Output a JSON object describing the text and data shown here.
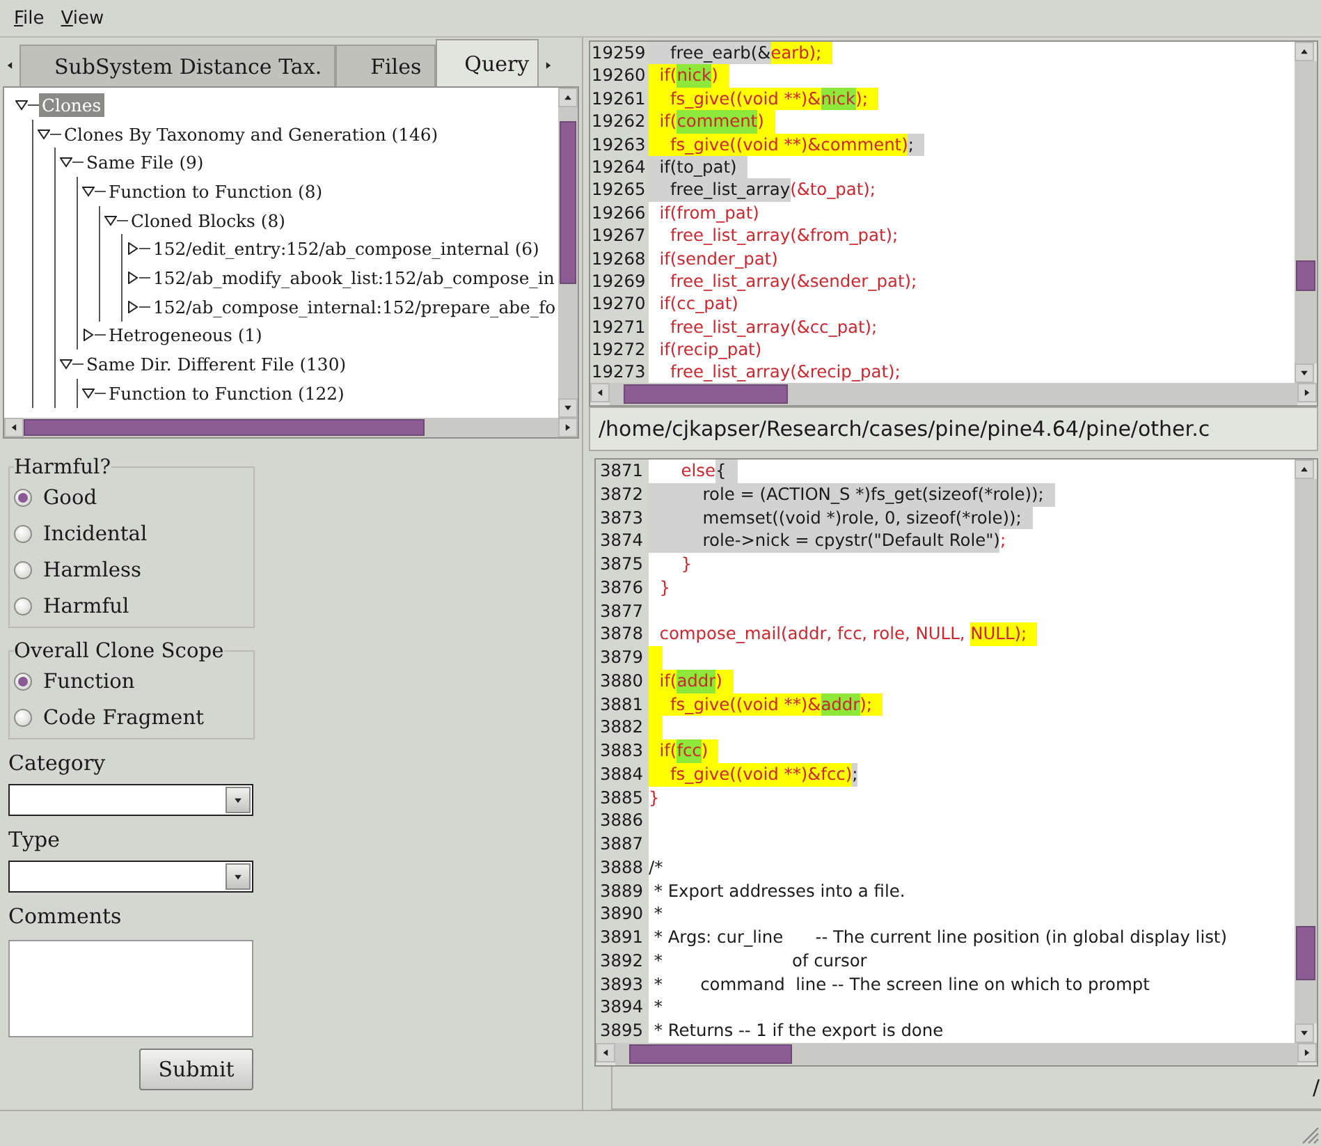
{
  "menu": [
    {
      "label": "File"
    },
    {
      "label": "View"
    }
  ],
  "tabs": [
    {
      "label": "SubSystem Distance Tax.",
      "selected": false
    },
    {
      "label": "Files",
      "selected": false
    },
    {
      "label": "Query",
      "selected": true
    }
  ],
  "tree": [
    {
      "label": "Clones",
      "selected": true,
      "expanded": true,
      "children": [
        {
          "label": "Clones By Taxonomy and Generation (146)",
          "selected": false,
          "expanded": true,
          "children": [
            {
              "label": "Same File (9)",
              "selected": false,
              "expanded": true,
              "children": [
                {
                  "label": "Function to Function (8)",
                  "selected": false,
                  "expanded": true,
                  "children": [
                    {
                      "label": "Cloned Blocks (8)",
                      "selected": false,
                      "expanded": true,
                      "children": [
                        {
                          "label": "152/edit_entry:152/ab_compose_internal (6)",
                          "selected": false,
                          "expanded": false
                        },
                        {
                          "label": "152/ab_modify_abook_list:152/ab_compose_in",
                          "selected": false,
                          "expanded": false
                        },
                        {
                          "label": "152/ab_compose_internal:152/prepare_abe_fo",
                          "selected": false,
                          "expanded": false
                        }
                      ]
                    }
                  ]
                },
                {
                  "label": "Hetrogeneous (1)",
                  "selected": false,
                  "expanded": false
                }
              ]
            },
            {
              "label": "Same Dir. Different File (130)",
              "selected": false,
              "expanded": true,
              "children": [
                {
                  "label": "Function to Function (122)",
                  "selected": false,
                  "expanded": true
                }
              ]
            }
          ]
        }
      ]
    }
  ],
  "form": {
    "groups": [
      {
        "title": "Harmful?",
        "options": [
          {
            "label": "Good",
            "selected": true
          },
          {
            "label": "Incidental",
            "selected": false
          },
          {
            "label": "Harmless",
            "selected": false
          },
          {
            "label": "Harmful",
            "selected": false
          }
        ]
      },
      {
        "title": "Overall Clone Scope",
        "options": [
          {
            "label": "Function",
            "selected": true
          },
          {
            "label": "Code Fragment",
            "selected": false
          }
        ]
      }
    ],
    "fields": [
      {
        "label": "Category",
        "kind": "dropdown"
      },
      {
        "label": "Type",
        "kind": "dropdown"
      },
      {
        "label": "Comments",
        "kind": "textarea"
      }
    ],
    "submit": "Submit"
  },
  "editors": [
    {
      "path": "/home/cjkapser/Research/cases/pine/pine4.64/pine/other.c",
      "lines": [
        {
          "num": "19259",
          "segments": [
            {
              "text": "    free_earb(&",
              "color": "#d2d2d2",
              "kind": "plain"
            },
            {
              "text": "earb);  ",
              "color": "#ffff00",
              "kind": "clone"
            }
          ]
        },
        {
          "num": "19260",
          "segments": [
            {
              "text": "  if(",
              "color": "#ffff00",
              "kind": "clone"
            },
            {
              "text": "nick",
              "color": "#8ee83a",
              "kind": "clone"
            },
            {
              "text": ")  ",
              "color": "#ffff00",
              "kind": "clone"
            }
          ]
        },
        {
          "num": "19261",
          "segments": [
            {
              "text": "    fs_give((void **)&",
              "color": "#ffff00",
              "kind": "clone"
            },
            {
              "text": "nick",
              "color": "#8ee83a",
              "kind": "clone"
            },
            {
              "text": ");  ",
              "color": "#ffff00",
              "kind": "clone"
            }
          ]
        },
        {
          "num": "19262",
          "segments": [
            {
              "text": "  if(",
              "color": "#ffff00",
              "kind": "clone"
            },
            {
              "text": "comment",
              "color": "#8ee83a",
              "kind": "clone"
            },
            {
              "text": ")  ",
              "color": "#ffff00",
              "kind": "clone"
            }
          ]
        },
        {
          "num": "19263",
          "segments": [
            {
              "text": "    fs_give((void **)&comment)",
              "color": "#ffff00",
              "kind": "clone"
            },
            {
              "text": ";  ",
              "color": "#d2d2d2",
              "kind": "plain"
            }
          ]
        },
        {
          "num": "19264",
          "segments": [
            {
              "text": "  if(to_pat)  ",
              "color": "#d2d2d2",
              "kind": "plain"
            }
          ]
        },
        {
          "num": "19265",
          "segments": [
            {
              "text": "    free_list_array",
              "color": "#d2d2d2",
              "kind": "plain"
            },
            {
              "text": "(&to_pat);",
              "kind": "clone"
            }
          ]
        },
        {
          "num": "19266",
          "segments": [
            {
              "text": "  if(from_pat)",
              "kind": "clone"
            }
          ]
        },
        {
          "num": "19267",
          "segments": [
            {
              "text": "    free_list_array(&from_pat);",
              "kind": "clone"
            }
          ]
        },
        {
          "num": "19268",
          "segments": [
            {
              "text": "  if(sender_pat)",
              "kind": "clone"
            }
          ]
        },
        {
          "num": "19269",
          "segments": [
            {
              "text": "    free_list_array(&sender_pat);",
              "kind": "clone"
            }
          ]
        },
        {
          "num": "19270",
          "segments": [
            {
              "text": "  if(cc_pat)",
              "kind": "clone"
            }
          ]
        },
        {
          "num": "19271",
          "segments": [
            {
              "text": "    free_list_array(&cc_pat);",
              "kind": "clone"
            }
          ]
        },
        {
          "num": "19272",
          "segments": [
            {
              "text": "  if(recip_pat)",
              "kind": "clone"
            }
          ]
        },
        {
          "num": "19273",
          "segments": [
            {
              "text": "    free_list_array(&recip_pat);",
              "kind": "clone"
            }
          ]
        }
      ]
    },
    {
      "path": "/",
      "lines": [
        {
          "num": "3871",
          "segments": [
            {
              "text": "      else",
              "kind": "clone"
            },
            {
              "text": "{  ",
              "color": "#d2d2d2",
              "kind": "plain"
            }
          ]
        },
        {
          "num": "3872",
          "segments": [
            {
              "text": "          role = (ACTION_S *)fs_get(sizeof(*role));  ",
              "color": "#d2d2d2",
              "kind": "plain"
            }
          ]
        },
        {
          "num": "3873",
          "segments": [
            {
              "text": "          memset((void *)role, 0, sizeof(*role));  ",
              "color": "#d2d2d2",
              "kind": "plain"
            }
          ]
        },
        {
          "num": "3874",
          "segments": [
            {
              "text": "          role->nick = cpystr(\"Default Role\")",
              "color": "#d2d2d2",
              "kind": "plain"
            },
            {
              "text": ";",
              "kind": "clone"
            }
          ]
        },
        {
          "num": "3875",
          "segments": [
            {
              "text": "      }",
              "kind": "clone"
            }
          ]
        },
        {
          "num": "3876",
          "segments": [
            {
              "text": "  }",
              "kind": "clone"
            }
          ]
        },
        {
          "num": "3877"
        },
        {
          "num": "3878",
          "segments": [
            {
              "text": "  compose_mail(addr, fcc, role, NULL, ",
              "kind": "clone"
            },
            {
              "text": "NULL);  ",
              "color": "#ffff00",
              "kind": "clone"
            }
          ]
        },
        {
          "num": "3879",
          "color": "#ffff00"
        },
        {
          "num": "3880",
          "segments": [
            {
              "text": "  if(",
              "color": "#ffff00",
              "kind": "clone"
            },
            {
              "text": "addr",
              "color": "#8ee83a",
              "kind": "clone"
            },
            {
              "text": ")  ",
              "color": "#ffff00",
              "kind": "clone"
            }
          ]
        },
        {
          "num": "3881",
          "segments": [
            {
              "text": "    fs_give((void **)&",
              "color": "#ffff00",
              "kind": "clone"
            },
            {
              "text": "addr",
              "color": "#8ee83a",
              "kind": "clone"
            },
            {
              "text": ");  ",
              "color": "#ffff00",
              "kind": "clone"
            }
          ]
        },
        {
          "num": "3882",
          "color": "#ffff00"
        },
        {
          "num": "3883",
          "segments": [
            {
              "text": "  if(",
              "color": "#ffff00",
              "kind": "clone"
            },
            {
              "text": "fcc",
              "color": "#8ee83a",
              "kind": "clone"
            },
            {
              "text": ")  ",
              "color": "#ffff00",
              "kind": "clone"
            }
          ]
        },
        {
          "num": "3884",
          "segments": [
            {
              "text": "    fs_give((void **)&fcc)",
              "color": "#ffff00",
              "kind": "clone"
            },
            {
              "text": ";",
              "color": "#d2d2d2",
              "kind": "plain"
            }
          ]
        },
        {
          "num": "3885",
          "segments": [
            {
              "text": "}",
              "kind": "clone"
            }
          ]
        },
        {
          "num": "3886"
        },
        {
          "num": "3887"
        },
        {
          "num": "3888",
          "segments": [
            {
              "text": "/*",
              "kind": "plain"
            }
          ]
        },
        {
          "num": "3889",
          "segments": [
            {
              "text": " * Export addresses into a file.",
              "kind": "plain"
            }
          ]
        },
        {
          "num": "3890",
          "segments": [
            {
              "text": " *",
              "kind": "plain"
            }
          ]
        },
        {
          "num": "3891",
          "segments": [
            {
              "text": " * Args: cur_line      -- The current line position (in global display list)",
              "kind": "plain"
            }
          ]
        },
        {
          "num": "3892",
          "segments": [
            {
              "text": " *                        of cursor",
              "kind": "plain"
            }
          ]
        },
        {
          "num": "3893",
          "segments": [
            {
              "text": " *       command  line -- The screen line on which to prompt",
              "kind": "plain"
            }
          ]
        },
        {
          "num": "3894",
          "segments": [
            {
              "text": " *",
              "kind": "plain"
            }
          ]
        },
        {
          "num": "3895",
          "segments": [
            {
              "text": " * Returns -- 1 if the export is done",
              "kind": "plain"
            }
          ]
        }
      ]
    }
  ]
}
